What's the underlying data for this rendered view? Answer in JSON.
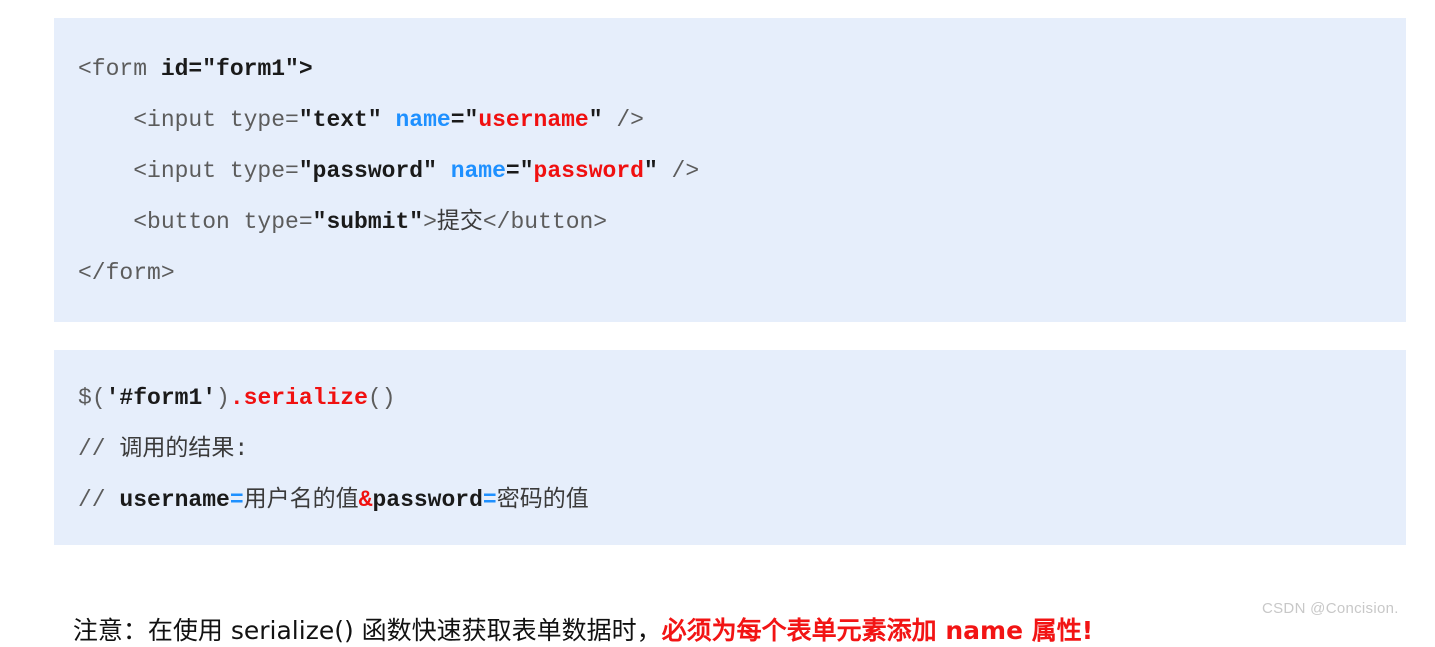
{
  "page": {
    "background_color": "#ffffff",
    "code_block_background": "#e6eefb"
  },
  "colors": {
    "code_plain": "#5c5c5c",
    "code_bold": "#1a1a1a",
    "attribute_blue": "#1e90ff",
    "value_red": "#f01010",
    "note_red": "#f21414",
    "watermark_gray": "#c8c8c8"
  },
  "code_block_form": {
    "name": "html-form-snippet",
    "lines": [
      {
        "id": "line-form-open",
        "tokens": [
          {
            "text": "<form ",
            "style": "plain"
          },
          {
            "text": "id=\"form1\">",
            "style": "bold"
          }
        ]
      },
      {
        "id": "line-input-username",
        "tokens": [
          {
            "text": "    <input type=",
            "style": "plain"
          },
          {
            "text": "\"text\"",
            "style": "bold"
          },
          {
            "text": " ",
            "style": "plain"
          },
          {
            "text": "name",
            "style": "attr"
          },
          {
            "text": "=\"",
            "style": "bold"
          },
          {
            "text": "username",
            "style": "red"
          },
          {
            "text": "\"",
            "style": "bold"
          },
          {
            "text": " />",
            "style": "plain"
          }
        ]
      },
      {
        "id": "line-input-password",
        "tokens": [
          {
            "text": "    <input type=",
            "style": "plain"
          },
          {
            "text": "\"password\"",
            "style": "bold"
          },
          {
            "text": " ",
            "style": "plain"
          },
          {
            "text": "name",
            "style": "attr"
          },
          {
            "text": "=\"",
            "style": "bold"
          },
          {
            "text": "password",
            "style": "red"
          },
          {
            "text": "\"",
            "style": "bold"
          },
          {
            "text": " />",
            "style": "plain"
          }
        ]
      },
      {
        "id": "line-button-submit",
        "tokens": [
          {
            "text": "    <button type=",
            "style": "plain"
          },
          {
            "text": "\"submit\"",
            "style": "bold"
          },
          {
            "text": ">",
            "style": "plain"
          },
          {
            "text": "提交",
            "style": "cn-mono"
          },
          {
            "text": "</button>",
            "style": "plain"
          }
        ]
      },
      {
        "id": "line-form-close",
        "tokens": [
          {
            "text": "</form>",
            "style": "plain"
          }
        ]
      }
    ]
  },
  "code_block_serialize": {
    "name": "jquery-serialize-snippet",
    "lines": [
      {
        "id": "line-serialize-call",
        "tokens": [
          {
            "text": "$",
            "style": "plain"
          },
          {
            "text": "(",
            "style": "plain"
          },
          {
            "text": "'#form1'",
            "style": "bold"
          },
          {
            "text": ")",
            "style": "plain"
          },
          {
            "text": ".",
            "style": "red"
          },
          {
            "text": "serialize",
            "style": "red"
          },
          {
            "text": "()",
            "style": "plain"
          }
        ]
      },
      {
        "id": "line-comment-result",
        "tokens": [
          {
            "text": "// ",
            "style": "plain"
          },
          {
            "text": "调用的结果:",
            "style": "cn-mono"
          }
        ]
      },
      {
        "id": "line-comment-output",
        "tokens": [
          {
            "text": "// ",
            "style": "plain"
          },
          {
            "text": "username",
            "style": "bold"
          },
          {
            "text": "=",
            "style": "eq"
          },
          {
            "text": "用户名的值",
            "style": "cn-mono"
          },
          {
            "text": "&",
            "style": "amp"
          },
          {
            "text": "password",
            "style": "bold"
          },
          {
            "text": "=",
            "style": "eq"
          },
          {
            "text": "密码的值",
            "style": "cn-mono"
          }
        ]
      }
    ]
  },
  "note": {
    "prefix": "注意：在使用 serialize() 函数快速获取表单数据时，",
    "emphasis": "必须为每个表单元素添加 name 属性",
    "suffix": "!"
  },
  "watermark": {
    "text": "CSDN @Concision."
  }
}
